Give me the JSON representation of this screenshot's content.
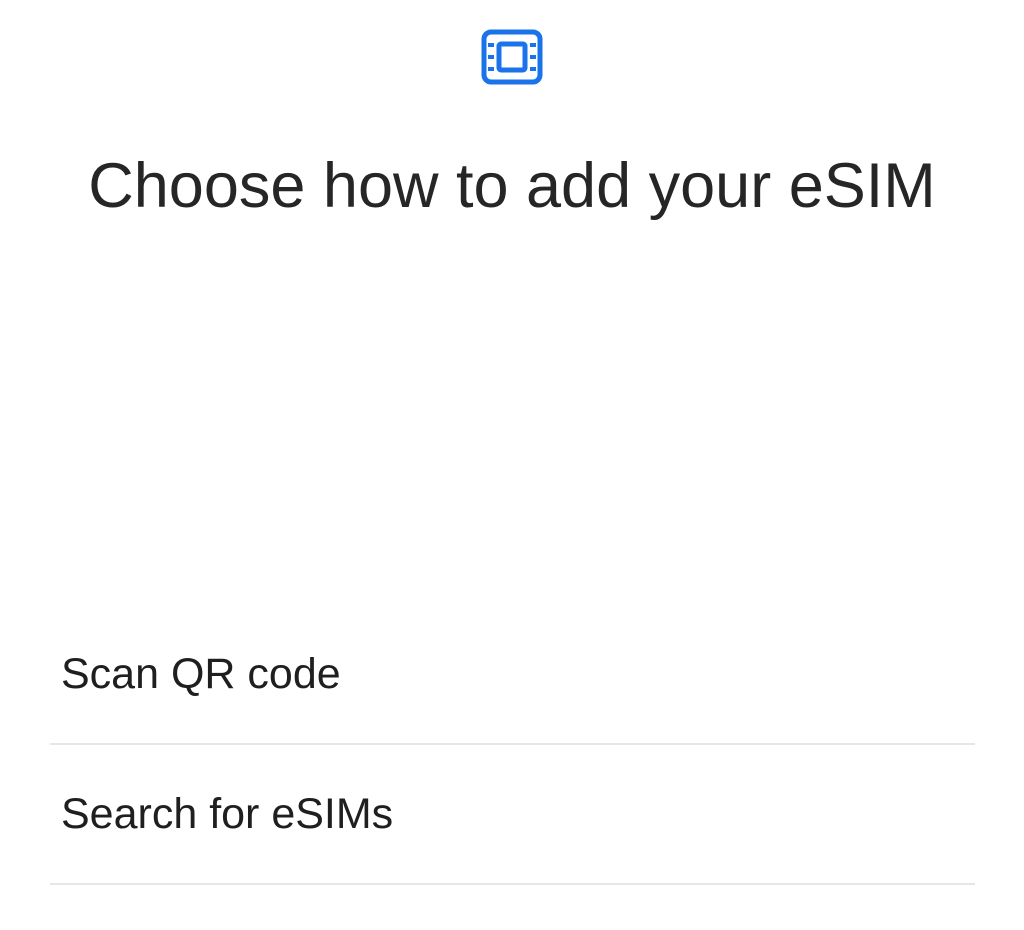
{
  "header": {
    "icon": "esim-chip-icon",
    "icon_color": "#1a73e8",
    "title": "Choose how to add your eSIM"
  },
  "options": [
    {
      "label": "Scan QR code"
    },
    {
      "label": "Search for eSIMs"
    }
  ]
}
